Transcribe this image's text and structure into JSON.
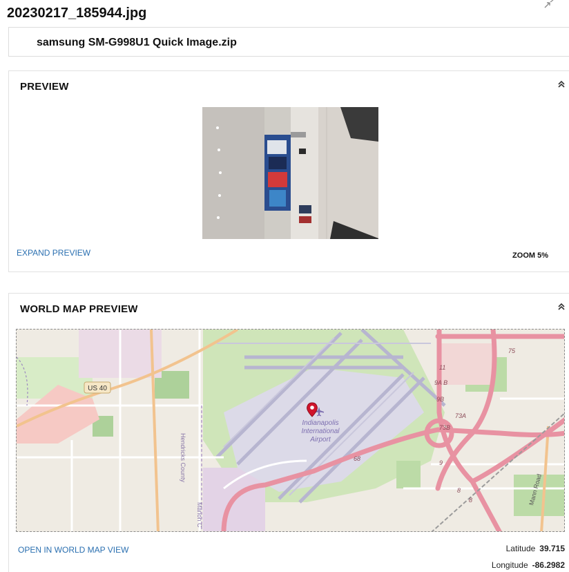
{
  "file": {
    "title": "20230217_185944.jpg",
    "source": "samsung SM-G998U1 Quick Image.zip"
  },
  "preview": {
    "title": "PREVIEW",
    "expand_label": "EXPAND PREVIEW",
    "zoom_label": "ZOOM 5%"
  },
  "map": {
    "title": "WORLD MAP PREVIEW",
    "open_label": "OPEN IN WORLD MAP VIEW",
    "latitude_label": "Latitude",
    "latitude": "39.715",
    "longitude_label": "Longitude",
    "longitude": "-86.2982",
    "labels": {
      "route": "US 40",
      "county_a": "Hendricks County",
      "county_b": "Marion C",
      "airport_1": "Indianapolis",
      "airport_2": "International",
      "airport_3": "Airport",
      "road": "Mann Road",
      "exit_11": "11",
      "exit_9ab": "9A B",
      "exit_9b": "9B",
      "exit_73a": "73A",
      "exit_73b": "73B",
      "exit_68": "68",
      "exit_9": "9",
      "exit_8a": "8",
      "exit_8b": "8",
      "exit_75": "75"
    }
  },
  "colors": {
    "accent_link": "#2a6fb0",
    "motorway": "#e892a2",
    "park": "#c8e2b3",
    "airport_area": "#d6d4e4",
    "pin": "#d0142c"
  },
  "icons": {
    "corner": "resize-icon",
    "collapse": "double-chevron-up-icon",
    "pin": "map-pin-icon",
    "airport": "airplane-icon"
  }
}
